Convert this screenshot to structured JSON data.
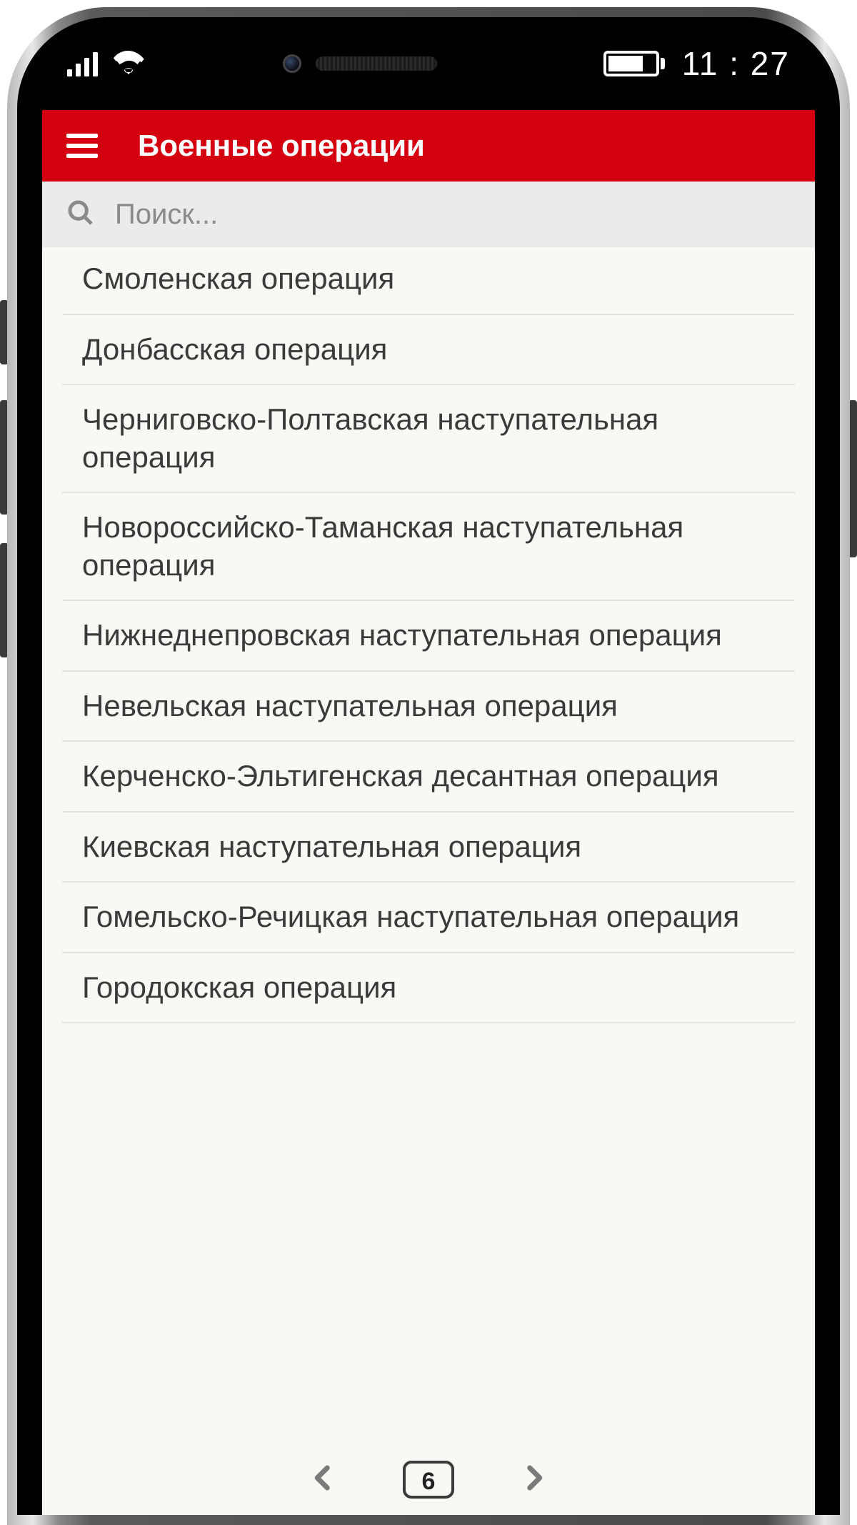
{
  "status": {
    "time": "11 : 27"
  },
  "header": {
    "title": "Военные операции"
  },
  "search": {
    "placeholder": "Поиск..."
  },
  "list": {
    "items": [
      "Смоленская операция",
      "Донбасская операция",
      "Черниговско-Полтавская наступательная операция",
      "Новороссийско-Таманская наступательная операция",
      "Нижнеднепровская наступательная операция",
      "Невельская наступательная операция",
      "Керченско-Эльтигенская десантная операция",
      "Киевская наступательная операция",
      "Гомельско-Речицкая наступательная операция",
      "Городокская операция"
    ]
  },
  "pager": {
    "current": "6"
  }
}
